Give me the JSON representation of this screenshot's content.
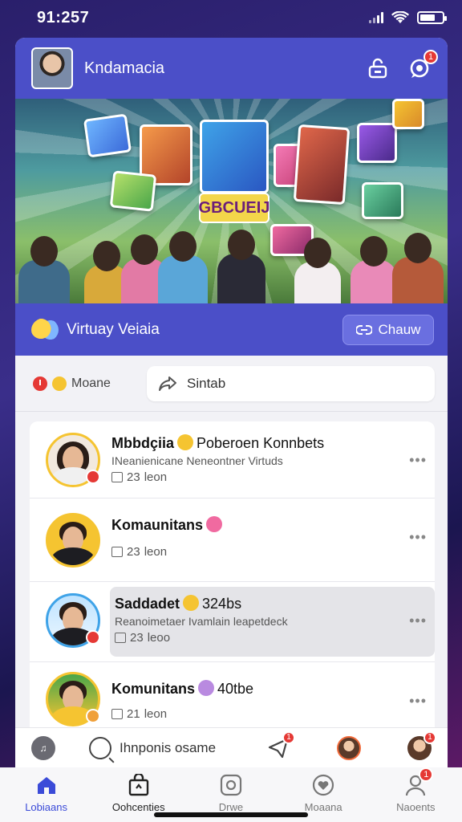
{
  "status_bar": {
    "time": "91:257"
  },
  "header": {
    "title": "Kndamacia",
    "notification_count": "1"
  },
  "banner": {
    "title": "GBCUEIJ"
  },
  "room_bar": {
    "label": "Virtuay Veiaia",
    "chat_button": "Chauw"
  },
  "filter": {
    "mode_label": "Moane",
    "share_label": "Sintab"
  },
  "feed": [
    {
      "name": "Mbbdçiia",
      "extra": "Poberoen Konnbets",
      "subtitle": "INeanienicane Neneontner Virtuds",
      "count": "23",
      "count_label": "leon",
      "avatar_body": "#f0f0f0",
      "ring": "#f5c431",
      "emoji_color": "#f5c431"
    },
    {
      "name": "Komaunitans",
      "extra": "",
      "subtitle": "",
      "count": "23",
      "count_label": "leon",
      "avatar_body": "#1d1d22",
      "ring": "#f5c431",
      "emoji_color": "#f06aa0"
    },
    {
      "name": "Saddadet",
      "extra": "324bs",
      "subtitle": "Reanoimetaer Ivamlain leapetdeck",
      "count": "23",
      "count_label": "leoo",
      "avatar_body": "#1d1d22",
      "ring": "#3fa3e8",
      "emoji_color": "#f5c431"
    },
    {
      "name": "Komunitans",
      "extra": "40tbe",
      "subtitle": "",
      "count": "21",
      "count_label": "leon",
      "avatar_body": "#f5c431",
      "ring": "#f5c431",
      "emoji_color": "#b98ae0"
    }
  ],
  "compose_bar": {
    "search_label": "Ihnponis osame",
    "message_badge": "1",
    "profile_badge": "1"
  },
  "tab_bar": [
    {
      "label": "Lobiaans",
      "icon": "home-icon"
    },
    {
      "label": "Oohcenties",
      "icon": "store-icon"
    },
    {
      "label": "Drwe",
      "icon": "camera-icon"
    },
    {
      "label": "Moaana",
      "icon": "heart-icon"
    },
    {
      "label": "Naoents",
      "icon": "profile-icon",
      "badge": "1"
    }
  ],
  "colors": {
    "accent": "#4b4fc8",
    "active_tab": "#3b4bd8",
    "badge": "#e53935"
  }
}
